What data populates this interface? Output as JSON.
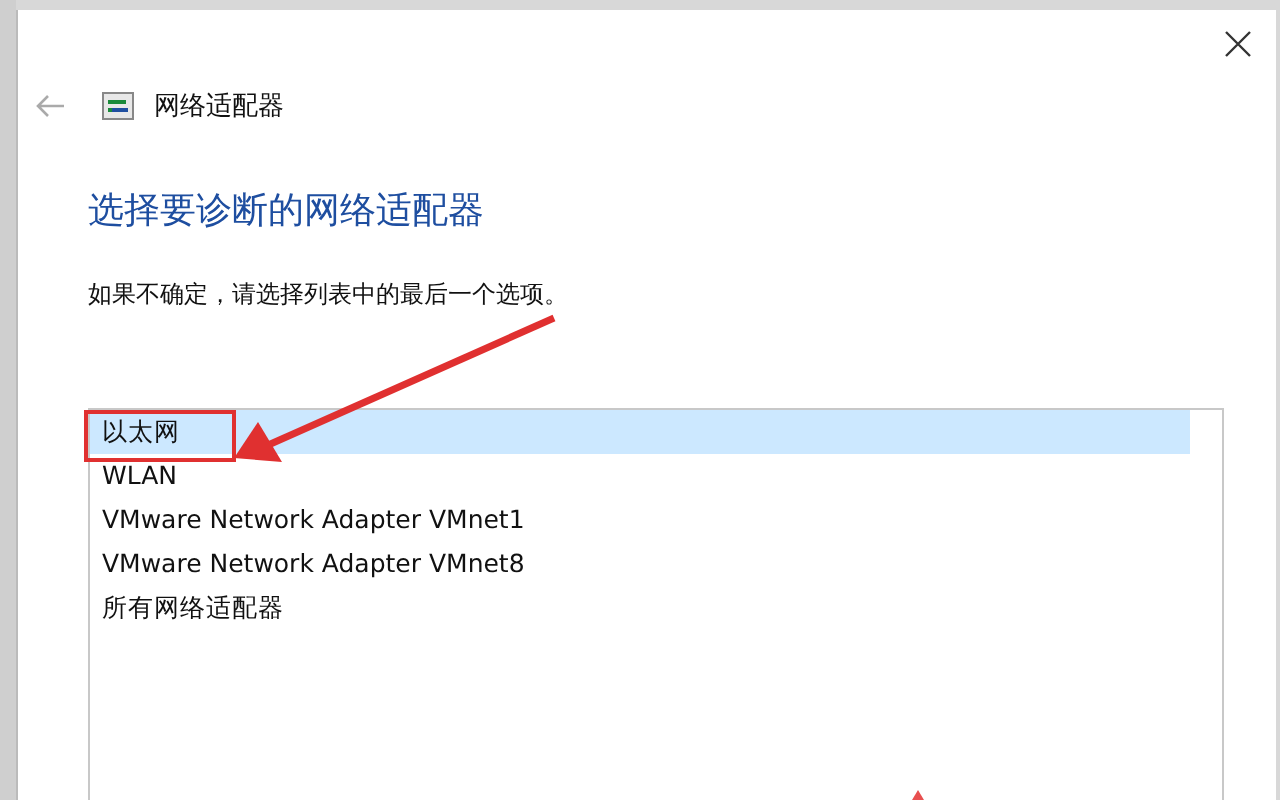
{
  "window": {
    "title": "网络适配器"
  },
  "heading": "选择要诊断的网络适配器",
  "instruction": "如果不确定，请选择列表中的最后一个选项。",
  "adapters": [
    {
      "label": "以太网",
      "selected": true,
      "outlined": true
    },
    {
      "label": "WLAN",
      "selected": false,
      "outlined": false
    },
    {
      "label": "VMware Network Adapter VMnet1",
      "selected": false,
      "outlined": false
    },
    {
      "label": "VMware Network Adapter VMnet8",
      "selected": false,
      "outlined": false
    },
    {
      "label": "所有网络适配器",
      "selected": false,
      "outlined": false
    }
  ]
}
